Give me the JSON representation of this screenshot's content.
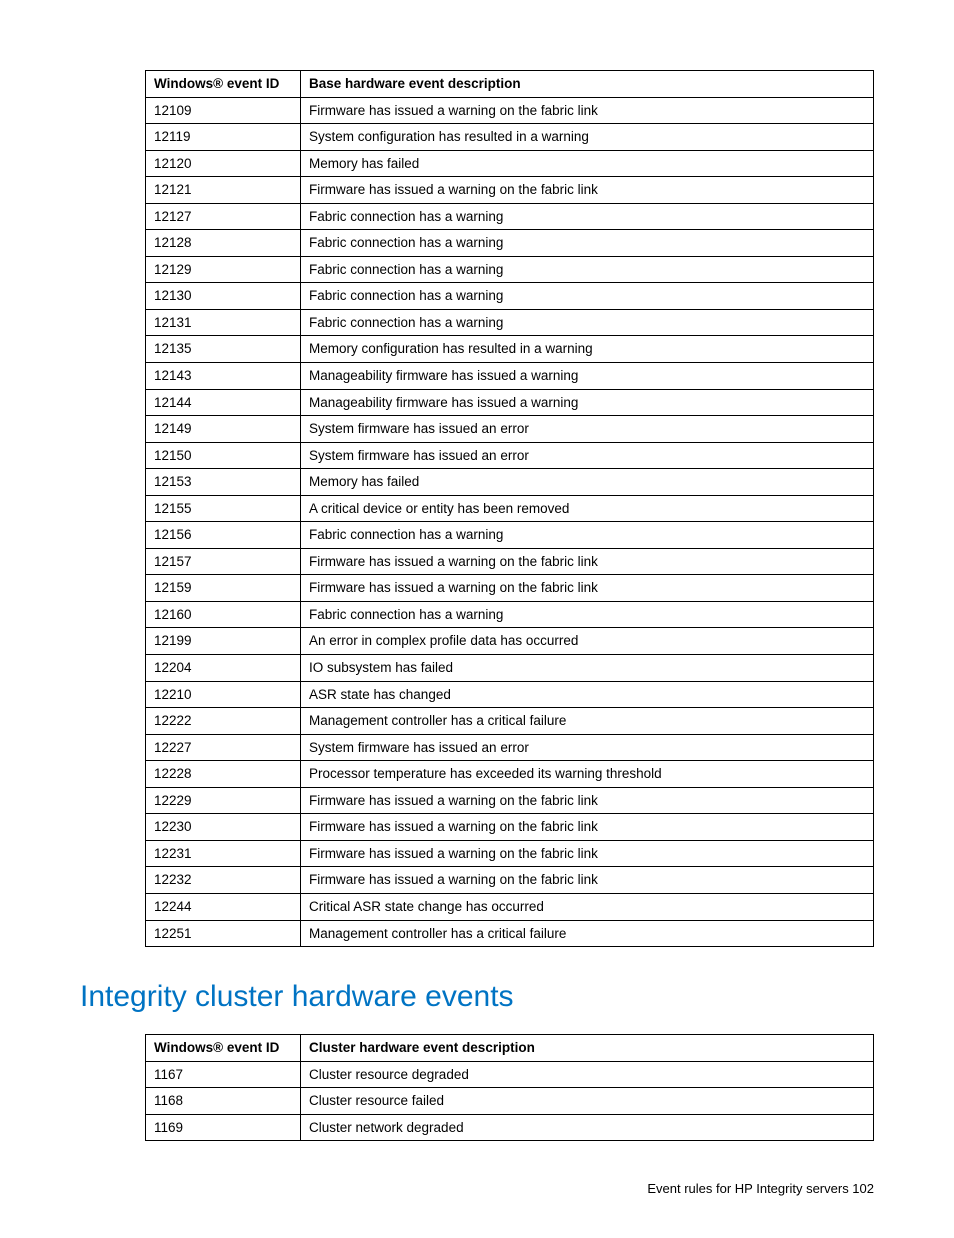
{
  "table1": {
    "headers": {
      "col1": "Windows® event ID",
      "col2": "Base hardware event description"
    },
    "rows": [
      {
        "id": "12109",
        "desc": "Firmware has issued a warning on the fabric link"
      },
      {
        "id": "12119",
        "desc": "System configuration has resulted in a warning"
      },
      {
        "id": "12120",
        "desc": "Memory has failed"
      },
      {
        "id": "12121",
        "desc": "Firmware has issued a warning on the fabric link"
      },
      {
        "id": "12127",
        "desc": "Fabric connection has a warning"
      },
      {
        "id": "12128",
        "desc": "Fabric connection has a warning"
      },
      {
        "id": "12129",
        "desc": "Fabric connection has a warning"
      },
      {
        "id": "12130",
        "desc": "Fabric connection has a warning"
      },
      {
        "id": "12131",
        "desc": "Fabric connection has a warning"
      },
      {
        "id": "12135",
        "desc": "Memory configuration has resulted in a warning"
      },
      {
        "id": "12143",
        "desc": "Manageability firmware has issued a warning"
      },
      {
        "id": "12144",
        "desc": "Manageability firmware has issued a warning"
      },
      {
        "id": "12149",
        "desc": "System firmware has issued an error"
      },
      {
        "id": "12150",
        "desc": "System firmware has issued an error"
      },
      {
        "id": "12153",
        "desc": "Memory has failed"
      },
      {
        "id": "12155",
        "desc": "A critical device or entity has been removed"
      },
      {
        "id": "12156",
        "desc": "Fabric connection has a warning"
      },
      {
        "id": "12157",
        "desc": "Firmware has issued a warning on the fabric link"
      },
      {
        "id": "12159",
        "desc": "Firmware has issued a warning on the fabric link"
      },
      {
        "id": "12160",
        "desc": "Fabric connection has a warning"
      },
      {
        "id": "12199",
        "desc": "An error in complex profile data has occurred"
      },
      {
        "id": "12204",
        "desc": "IO subsystem has failed"
      },
      {
        "id": "12210",
        "desc": "ASR state has changed"
      },
      {
        "id": "12222",
        "desc": "Management controller has a critical failure"
      },
      {
        "id": "12227",
        "desc": "System firmware has issued an error"
      },
      {
        "id": "12228",
        "desc": "Processor temperature has exceeded its warning threshold"
      },
      {
        "id": "12229",
        "desc": "Firmware has issued a warning on the fabric link"
      },
      {
        "id": "12230",
        "desc": "Firmware has issued a warning on the fabric link"
      },
      {
        "id": "12231",
        "desc": "Firmware has issued a warning on the fabric link"
      },
      {
        "id": "12232",
        "desc": "Firmware has issued a warning on the fabric link"
      },
      {
        "id": "12244",
        "desc": "Critical ASR state change has occurred"
      },
      {
        "id": "12251",
        "desc": "Management controller has a critical failure"
      }
    ]
  },
  "section_heading": "Integrity cluster hardware events",
  "table2": {
    "headers": {
      "col1": "Windows® event ID",
      "col2": "Cluster hardware event description"
    },
    "rows": [
      {
        "id": "1167",
        "desc": "Cluster resource degraded"
      },
      {
        "id": "1168",
        "desc": "Cluster resource failed"
      },
      {
        "id": "1169",
        "desc": "Cluster network degraded"
      }
    ]
  },
  "footer": "Event rules for HP Integrity servers   102"
}
